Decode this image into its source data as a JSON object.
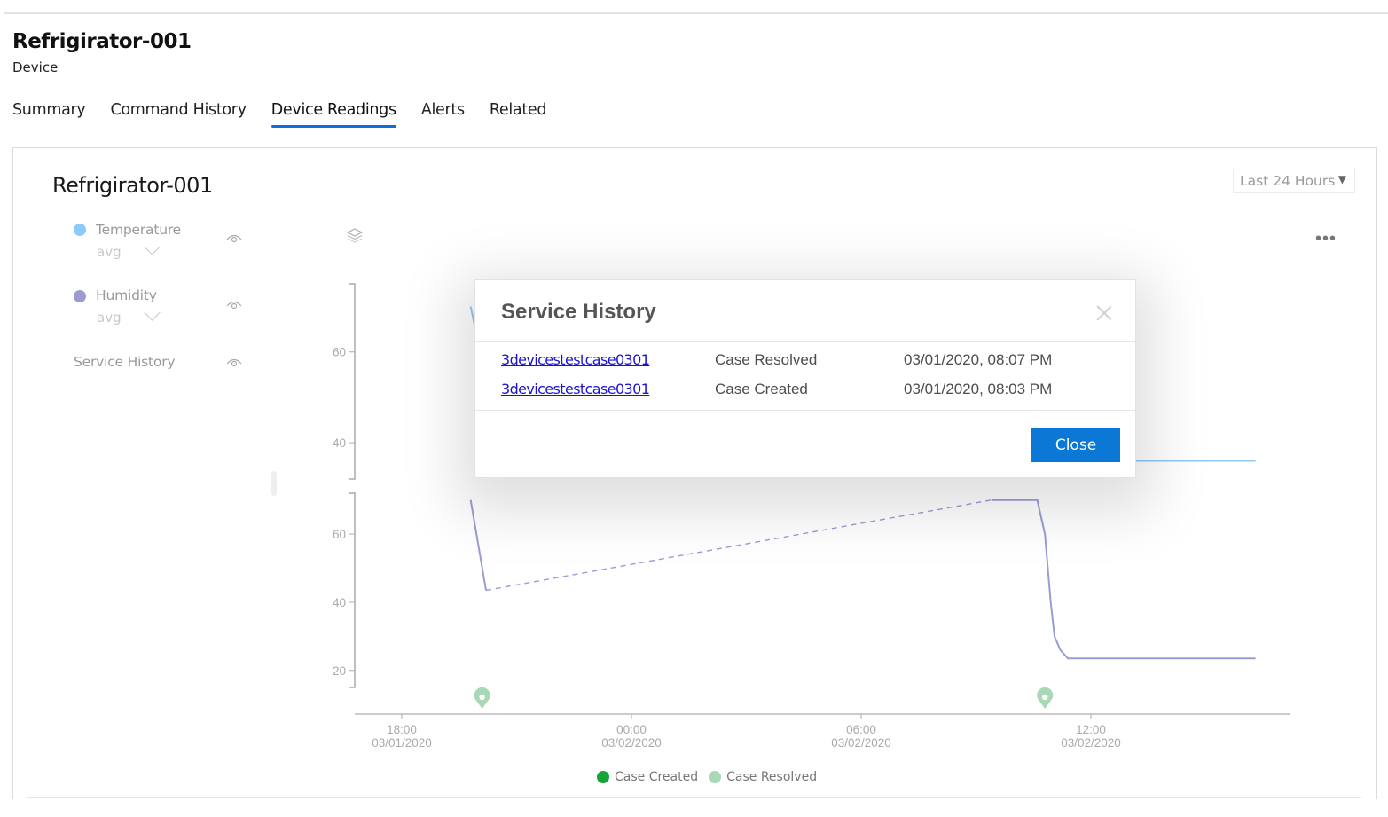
{
  "header": {
    "title": "Refrigirator-001",
    "subtitle": "Device"
  },
  "tabs": [
    {
      "label": "Summary",
      "active": false
    },
    {
      "label": "Command History",
      "active": false
    },
    {
      "label": "Device Readings",
      "active": true
    },
    {
      "label": "Alerts",
      "active": false
    },
    {
      "label": "Related",
      "active": false
    }
  ],
  "card": {
    "title": "Refrigirator-001",
    "time_range": "Last 24 Hours",
    "more_label": "•••"
  },
  "legend": {
    "items": [
      {
        "label": "Temperature",
        "aggregate": "avg",
        "color": "#8ec9f7"
      },
      {
        "label": "Humidity",
        "aggregate": "avg",
        "color": "#9a9cd6"
      },
      {
        "label": "Service History",
        "aggregate": null,
        "color": null
      }
    ]
  },
  "colors": {
    "accent": "#0f6cdc",
    "button": "#0a78d4",
    "link": "#1a13d6",
    "case_created": "#16a43a",
    "case_resolved": "#a8d8b5"
  },
  "dialog": {
    "title": "Service History",
    "rows": [
      {
        "case": "3devicestestcase0301",
        "event": "Case Resolved",
        "timestamp": "03/01/2020, 08:07 PM"
      },
      {
        "case": "3devicestestcase0301",
        "event": "Case Created",
        "timestamp": "03/01/2020, 08:03 PM"
      }
    ],
    "close_label": "Close"
  },
  "bottom_legend": [
    {
      "label": "Case Created",
      "color": "#16a43a"
    },
    {
      "label": "Case Resolved",
      "color": "#a8d8b5"
    }
  ],
  "chart_data": {
    "type": "line",
    "x_ticks": [
      {
        "time": "18:00",
        "date": "03/01/2020",
        "hours": 0
      },
      {
        "time": "00:00",
        "date": "03/02/2020",
        "hours": 6
      },
      {
        "time": "06:00",
        "date": "03/02/2020",
        "hours": 12
      },
      {
        "time": "12:00",
        "date": "03/02/2020",
        "hours": 18
      }
    ],
    "xlim_hours": [
      -1.2,
      23.1
    ],
    "panels": [
      {
        "name": "Temperature",
        "ylim": [
          32,
          75
        ],
        "y_ticks": [
          40,
          60
        ],
        "series": [
          {
            "name": "Temperature",
            "color": "#8ec9f7",
            "style": "solid",
            "points": [
              [
                1.8,
                70
              ],
              [
                2.1,
                58
              ]
            ]
          },
          {
            "name": "Temperature",
            "color": "#8ec9f7",
            "style": "solid",
            "points": [
              [
                16.9,
                36
              ],
              [
                22.3,
                36
              ]
            ]
          }
        ]
      },
      {
        "name": "Humidity",
        "ylim": [
          15,
          72
        ],
        "y_ticks": [
          20,
          40,
          60
        ],
        "series": [
          {
            "name": "Humidity",
            "color": "#9a9cd6",
            "style": "solid",
            "points": [
              [
                1.8,
                70
              ],
              [
                2.2,
                43.5
              ]
            ]
          },
          {
            "name": "Humidity-gap",
            "color": "#9a9cd6",
            "style": "dashed",
            "points": [
              [
                2.2,
                43.5
              ],
              [
                15.4,
                70
              ]
            ]
          },
          {
            "name": "Humidity",
            "color": "#9a9cd6",
            "style": "solid",
            "points": [
              [
                15.4,
                70
              ],
              [
                16.6,
                70
              ],
              [
                16.8,
                60
              ],
              [
                16.95,
                40
              ],
              [
                17.05,
                30
              ],
              [
                17.2,
                26
              ],
              [
                17.4,
                23.5
              ],
              [
                22.3,
                23.5
              ]
            ]
          }
        ]
      }
    ],
    "events": [
      {
        "type": "Case Resolved",
        "hours": 2.1
      },
      {
        "type": "Case Resolved",
        "hours": 16.8
      }
    ]
  }
}
